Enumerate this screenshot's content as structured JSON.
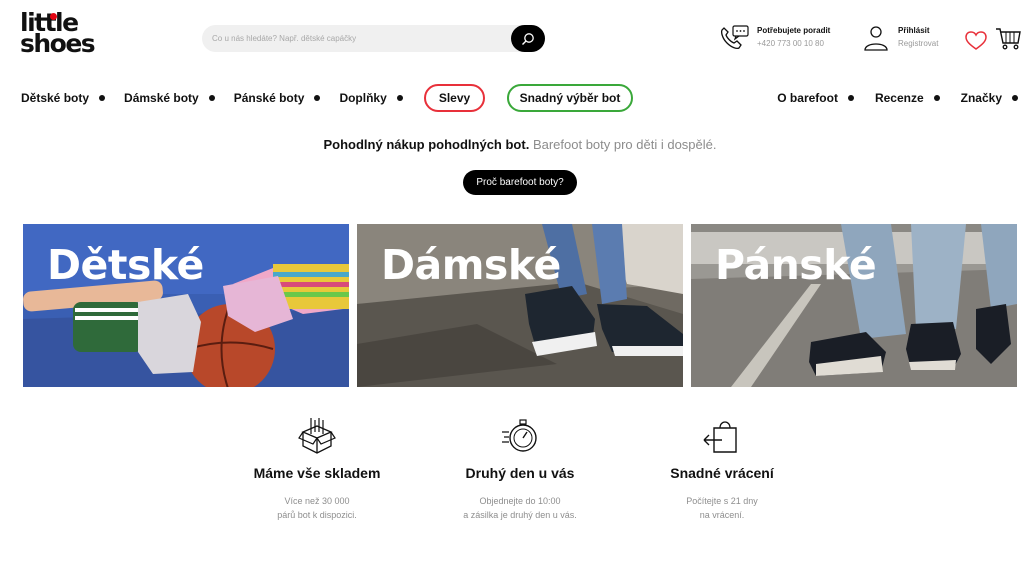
{
  "brand": {
    "line1": "little",
    "line2": "shoes",
    "accent": "#e30613"
  },
  "search": {
    "placeholder": "Co u nás hledáte? Např. dětské capáčky",
    "icon": "search-icon"
  },
  "header": {
    "help_title": "Potřebujete poradit",
    "help_phone": "+420 773 00 10 80",
    "login_title": "Přihlásit",
    "login_sub": "Registrovat"
  },
  "nav": {
    "left": [
      "Dětské boty",
      "Dámské boty",
      "Pánské boty",
      "Doplňky"
    ],
    "sale": "Slevy",
    "easy_pick": "Snadný výběr bot",
    "right": [
      "O barefoot",
      "Recenze",
      "Značky"
    ],
    "sale_color": "#e8303a",
    "easy_pick_color": "#3aa83a"
  },
  "hero": {
    "tagline_bold": "Pohodlný nákup pohodlných bot.",
    "tagline_light": "Barefoot boty pro děti i dospělé.",
    "cta": "Proč barefoot boty?"
  },
  "categories": [
    "Dětské",
    "Dámské",
    "Pánské"
  ],
  "features": [
    {
      "icon": "boxes-icon",
      "title": "Máme vše skladem",
      "text1": "Více než 30 000",
      "text2": "párů bot k dispozici."
    },
    {
      "icon": "stopwatch-icon",
      "title": "Druhý den u vás",
      "text1": "Objednejte do 10:00",
      "text2": "a zásilka je druhý den u vás."
    },
    {
      "icon": "return-bag-icon",
      "title": "Snadné vrácení",
      "text1": "Počítejte s 21 dny",
      "text2": "na vrácení."
    }
  ]
}
